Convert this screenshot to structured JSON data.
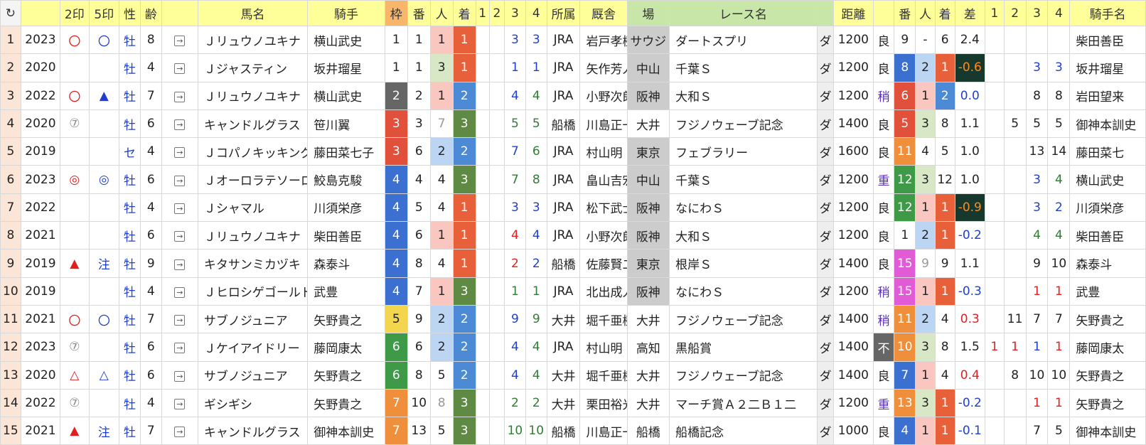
{
  "header": {
    "refresh_icon": "↻",
    "cols": [
      "",
      "2印",
      "5印",
      "性",
      "齢",
      "",
      "馬名",
      "騎手",
      "枠",
      "番",
      "人",
      "着",
      "1",
      "2",
      "3",
      "4",
      "所属",
      "厩舎",
      "場",
      "レース名",
      "",
      "距離",
      "",
      "番",
      "人",
      "着",
      "差",
      "1",
      "2",
      "3",
      "4",
      "騎手名"
    ]
  },
  "colors": {
    "waku": {
      "1": "#ffffff",
      "2": "#666666",
      "3": "#e0503a",
      "4": "#3b6fd0",
      "5": "#f3d54e",
      "6": "#3f9a47",
      "7": "#ef8f3b",
      "8": "#e15ad6"
    },
    "chaku": {
      "1": "#e8603a",
      "2": "#4d8ad6",
      "3": "#5f8a43"
    },
    "ninki": {
      "1": "#f9c7c0",
      "2": "#bcd5f2",
      "3": "#d8e8c7"
    },
    "ban2": {
      "4": "#3b6fd0",
      "5": "#e0503a",
      "6": "#e0503a",
      "7": "#3b6fd0",
      "8": "#3b6fd0",
      "9": "#ffffff",
      "10": "#ef8f3b",
      "11": "#ef8f3b",
      "12": "#3f9a47",
      "13": "#ef8f3b",
      "15": "#e15ad6"
    },
    "ba_grey": "#cccccc",
    "diff_dark": "#17382d"
  },
  "rows": [
    {
      "idx": "1",
      "year": "2023",
      "m2": "〇",
      "m5": "〇",
      "sex": "牡",
      "age": "8",
      "name": "Ｊリュウノユキナ",
      "jockey": "横山武史",
      "waku": "1",
      "ban": "1",
      "ninki": "1",
      "chaku": "1",
      "c1": "",
      "c2": "",
      "c3": "3",
      "c4": "3",
      "shozoku": "JRA",
      "kyusha": "岩戸孝樹",
      "ba": "サウジ",
      "race": "ダートスプリ",
      "surface": "ダ",
      "dist": "1200",
      "baba": "良",
      "ban2": "9",
      "ninki2": "-",
      "chaku2": "6",
      "sa": "2.4",
      "p1": "",
      "p2": "",
      "p3": "",
      "p4": "",
      "jockey2": "柴田善臣"
    },
    {
      "idx": "2",
      "year": "2020",
      "m2": "",
      "m5": "",
      "sex": "牡",
      "age": "4",
      "name": "Ｊジャスティン",
      "jockey": "坂井瑠星",
      "waku": "1",
      "ban": "1",
      "ninki": "3",
      "chaku": "1",
      "c1": "",
      "c2": "",
      "c3": "1",
      "c4": "1",
      "shozoku": "JRA",
      "kyusha": "矢作芳人",
      "ba": "中山",
      "race": "千葉Ｓ",
      "surface": "ダ",
      "dist": "1200",
      "baba": "良",
      "ban2": "8",
      "ninki2": "2",
      "chaku2": "1",
      "sa": "-0.6",
      "p1": "",
      "p2": "",
      "p3": "3",
      "p4": "3",
      "jockey2": "坂井瑠星"
    },
    {
      "idx": "3",
      "year": "2022",
      "m2": "〇",
      "m5": "▲",
      "sex": "牡",
      "age": "7",
      "name": "Ｊリュウノユキナ",
      "jockey": "横山武史",
      "waku": "2",
      "ban": "2",
      "ninki": "1",
      "chaku": "2",
      "c1": "",
      "c2": "",
      "c3": "4",
      "c4": "4",
      "shozoku": "JRA",
      "kyusha": "小野次郎",
      "ba": "阪神",
      "race": "大和Ｓ",
      "surface": "ダ",
      "dist": "1200",
      "baba": "稍",
      "ban2": "6",
      "ninki2": "1",
      "chaku2": "2",
      "sa": "0.0",
      "p1": "",
      "p2": "",
      "p3": "8",
      "p4": "8",
      "jockey2": "岩田望来"
    },
    {
      "idx": "4",
      "year": "2020",
      "m2": "⑦",
      "m5": "",
      "sex": "牡",
      "age": "6",
      "name": "キャンドルグラス",
      "jockey": "笹川翼",
      "waku": "3",
      "ban": "3",
      "ninki": "7",
      "chaku": "3",
      "c1": "",
      "c2": "",
      "c3": "5",
      "c4": "5",
      "shozoku": "船橋",
      "kyusha": "川島正一",
      "ba": "大井",
      "race": "フジノウェーブ記念",
      "surface": "ダ",
      "dist": "1400",
      "baba": "良",
      "ban2": "5",
      "ninki2": "3",
      "chaku2": "8",
      "sa": "1.1",
      "p1": "",
      "p2": "5",
      "p3": "5",
      "p4": "5",
      "jockey2": "御神本訓史"
    },
    {
      "idx": "5",
      "year": "2019",
      "m2": "",
      "m5": "",
      "sex": "セ",
      "age": "4",
      "name": "Ｊコパノキッキング",
      "jockey": "藤田菜七子",
      "waku": "3",
      "ban": "6",
      "ninki": "2",
      "chaku": "2",
      "c1": "",
      "c2": "",
      "c3": "7",
      "c4": "6",
      "shozoku": "JRA",
      "kyusha": "村山明",
      "ba": "東京",
      "race": "フェブラリー",
      "surface": "ダ",
      "dist": "1600",
      "baba": "良",
      "ban2": "11",
      "ninki2": "4",
      "chaku2": "5",
      "sa": "1.0",
      "p1": "",
      "p2": "",
      "p3": "13",
      "p4": "14",
      "jockey2": "藤田菜七"
    },
    {
      "idx": "6",
      "year": "2023",
      "m2": "◎",
      "m5": "◎",
      "sex": "牡",
      "age": "6",
      "name": "Ｊオーロラテソーロ",
      "jockey": "鮫島克駿",
      "waku": "4",
      "ban": "4",
      "ninki": "4",
      "chaku": "3",
      "c1": "",
      "c2": "",
      "c3": "7",
      "c4": "8",
      "shozoku": "JRA",
      "kyusha": "畠山吉宏",
      "ba": "中山",
      "race": "千葉Ｓ",
      "surface": "ダ",
      "dist": "1200",
      "baba": "重",
      "ban2": "12",
      "ninki2": "3",
      "chaku2": "12",
      "sa": "1.0",
      "p1": "",
      "p2": "",
      "p3": "3",
      "p4": "4",
      "jockey2": "横山武史"
    },
    {
      "idx": "7",
      "year": "2022",
      "m2": "",
      "m5": "",
      "sex": "牡",
      "age": "4",
      "name": "Ｊシャマル",
      "jockey": "川須栄彦",
      "waku": "4",
      "ban": "5",
      "ninki": "4",
      "chaku": "1",
      "c1": "",
      "c2": "",
      "c3": "3",
      "c4": "3",
      "shozoku": "JRA",
      "kyusha": "松下武士",
      "ba": "阪神",
      "race": "なにわＳ",
      "surface": "ダ",
      "dist": "1200",
      "baba": "良",
      "ban2": "12",
      "ninki2": "1",
      "chaku2": "1",
      "sa": "-0.9",
      "p1": "",
      "p2": "",
      "p3": "3",
      "p4": "2",
      "jockey2": "川須栄彦"
    },
    {
      "idx": "8",
      "year": "2021",
      "m2": "",
      "m5": "",
      "sex": "牡",
      "age": "6",
      "name": "Ｊリュウノユキナ",
      "jockey": "柴田善臣",
      "waku": "4",
      "ban": "6",
      "ninki": "1",
      "chaku": "1",
      "c1": "",
      "c2": "",
      "c3": "4",
      "c4": "4",
      "shozoku": "JRA",
      "kyusha": "小野次郎",
      "ba": "阪神",
      "race": "大和Ｓ",
      "surface": "ダ",
      "dist": "1200",
      "baba": "良",
      "ban2": "1",
      "ninki2": "2",
      "chaku2": "1",
      "sa": "-0.2",
      "p1": "",
      "p2": "",
      "p3": "4",
      "p4": "4",
      "jockey2": "柴田善臣"
    },
    {
      "idx": "9",
      "year": "2019",
      "m2": "▲",
      "m5": "注",
      "sex": "牡",
      "age": "9",
      "name": "キタサンミカヅキ",
      "jockey": "森泰斗",
      "waku": "4",
      "ban": "8",
      "ninki": "4",
      "chaku": "1",
      "c1": "",
      "c2": "",
      "c3": "2",
      "c4": "2",
      "shozoku": "船橋",
      "kyusha": "佐藤賢二",
      "ba": "東京",
      "race": "根岸Ｓ",
      "surface": "ダ",
      "dist": "1400",
      "baba": "良",
      "ban2": "15",
      "ninki2": "9",
      "chaku2": "9",
      "sa": "1.1",
      "p1": "",
      "p2": "",
      "p3": "9",
      "p4": "10",
      "jockey2": "森泰斗"
    },
    {
      "idx": "10",
      "year": "2019",
      "m2": "",
      "m5": "",
      "sex": "牡",
      "age": "4",
      "name": "Ｊヒロシゲゴールド",
      "jockey": "武豊",
      "waku": "4",
      "ban": "7",
      "ninki": "1",
      "chaku": "3",
      "c1": "",
      "c2": "",
      "c3": "1",
      "c4": "1",
      "shozoku": "JRA",
      "kyusha": "北出成人",
      "ba": "阪神",
      "race": "なにわＳ",
      "surface": "ダ",
      "dist": "1200",
      "baba": "稍",
      "ban2": "15",
      "ninki2": "1",
      "chaku2": "1",
      "sa": "-0.3",
      "p1": "",
      "p2": "",
      "p3": "1",
      "p4": "1",
      "jockey2": "武豊"
    },
    {
      "idx": "11",
      "year": "2021",
      "m2": "〇",
      "m5": "〇",
      "sex": "牡",
      "age": "7",
      "name": "サブノジュニア",
      "jockey": "矢野貴之",
      "waku": "5",
      "ban": "9",
      "ninki": "2",
      "chaku": "2",
      "c1": "",
      "c2": "",
      "c3": "9",
      "c4": "9",
      "shozoku": "大井",
      "kyusha": "堀千亜樹",
      "ba": "大井",
      "race": "フジノウェーブ記念",
      "surface": "ダ",
      "dist": "1400",
      "baba": "稍",
      "ban2": "11",
      "ninki2": "2",
      "chaku2": "4",
      "sa": "0.3",
      "p1": "",
      "p2": "11",
      "p3": "7",
      "p4": "7",
      "jockey2": "矢野貴之"
    },
    {
      "idx": "12",
      "year": "2023",
      "m2": "⑦",
      "m5": "",
      "sex": "牡",
      "age": "6",
      "name": "Ｊケイアイドリー",
      "jockey": "藤岡康太",
      "waku": "6",
      "ban": "6",
      "ninki": "2",
      "chaku": "2",
      "c1": "",
      "c2": "",
      "c3": "4",
      "c4": "4",
      "shozoku": "JRA",
      "kyusha": "村山明",
      "ba": "高知",
      "race": "黒船賞",
      "surface": "ダ",
      "dist": "1400",
      "baba": "不",
      "ban2": "10",
      "ninki2": "3",
      "chaku2": "8",
      "sa": "1.5",
      "p1": "1",
      "p2": "1",
      "p3": "1",
      "p4": "1",
      "jockey2": "藤岡康太"
    },
    {
      "idx": "13",
      "year": "2020",
      "m2": "△",
      "m5": "△",
      "sex": "牡",
      "age": "6",
      "name": "サブノジュニア",
      "jockey": "矢野貴之",
      "waku": "6",
      "ban": "8",
      "ninki": "5",
      "chaku": "2",
      "c1": "",
      "c2": "",
      "c3": "4",
      "c4": "4",
      "shozoku": "大井",
      "kyusha": "堀千亜樹",
      "ba": "大井",
      "race": "フジノウェーブ記念",
      "surface": "ダ",
      "dist": "1400",
      "baba": "良",
      "ban2": "7",
      "ninki2": "1",
      "chaku2": "4",
      "sa": "0.4",
      "p1": "",
      "p2": "8",
      "p3": "10",
      "p4": "10",
      "jockey2": "矢野貴之"
    },
    {
      "idx": "14",
      "year": "2022",
      "m2": "⑦",
      "m5": "",
      "sex": "牡",
      "age": "4",
      "name": "ギシギシ",
      "jockey": "矢野貴之",
      "waku": "7",
      "ban": "10",
      "ninki": "8",
      "chaku": "3",
      "c1": "",
      "c2": "",
      "c3": "2",
      "c4": "2",
      "shozoku": "大井",
      "kyusha": "栗田裕光",
      "ba": "大井",
      "race": "マーチ賞Ａ２二Ｂ１二",
      "surface": "ダ",
      "dist": "1200",
      "baba": "重",
      "ban2": "13",
      "ninki2": "3",
      "chaku2": "1",
      "sa": "-0.2",
      "p1": "",
      "p2": "",
      "p3": "1",
      "p4": "1",
      "jockey2": "矢野貴之"
    },
    {
      "idx": "15",
      "year": "2021",
      "m2": "▲",
      "m5": "注",
      "sex": "牡",
      "age": "7",
      "name": "キャンドルグラス",
      "jockey": "御神本訓史",
      "waku": "7",
      "ban": "13",
      "ninki": "5",
      "chaku": "3",
      "c1": "",
      "c2": "",
      "c3": "10",
      "c4": "10",
      "shozoku": "船橋",
      "kyusha": "川島正一",
      "ba": "船橋",
      "race": "船橋記念",
      "surface": "ダ",
      "dist": "1000",
      "baba": "良",
      "ban2": "4",
      "ninki2": "1",
      "chaku2": "1",
      "sa": "-0.1",
      "p1": "",
      "p2": "",
      "p3": "7",
      "p4": "5",
      "jockey2": "御神本訓史"
    }
  ]
}
